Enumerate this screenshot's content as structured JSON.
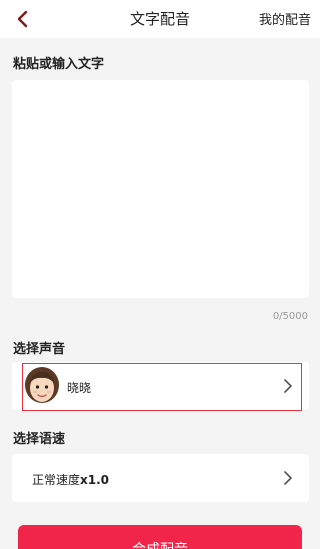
{
  "header": {
    "title": "文字配音",
    "my_dubbing": "我的配音"
  },
  "text_input": {
    "label": "粘贴或输入文字",
    "value": "",
    "counter": "0/5000"
  },
  "voice": {
    "label": "选择声音",
    "selected": "晓晓"
  },
  "speed": {
    "label": "选择语速",
    "value_prefix": "正常速度",
    "value_multiplier": "x1.0"
  },
  "action": {
    "synthesize_label": "合成配音"
  },
  "colors": {
    "accent": "#f1254a",
    "back_icon": "#7a1b1b",
    "highlight_border": "#e8323c"
  }
}
